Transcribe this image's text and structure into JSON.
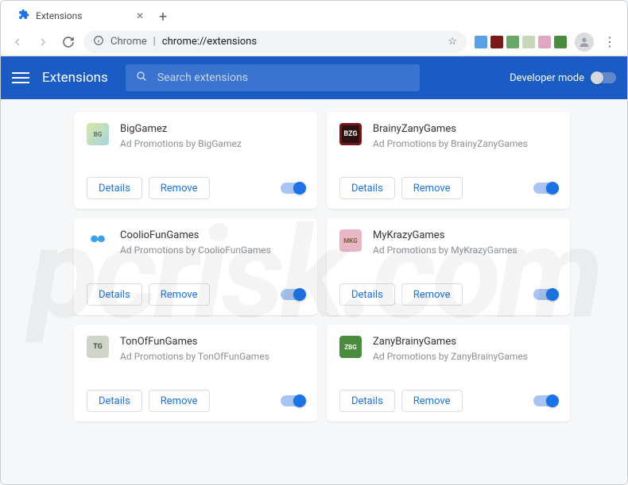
{
  "window": {
    "tab_title": "Extensions"
  },
  "toolbar": {
    "omni_host": "Chrome",
    "omni_url": "chrome://extensions"
  },
  "appbar": {
    "title": "Extensions",
    "search_placeholder": "Search extensions",
    "dev_mode_label": "Developer mode"
  },
  "buttons": {
    "details": "Details",
    "remove": "Remove"
  },
  "extensions": [
    {
      "name": "BigGamez",
      "desc": "Ad Promotions by BigGamez",
      "icon": "bg",
      "abbr": "BG"
    },
    {
      "name": "BrainyZanyGames",
      "desc": "Ad Promotions by BrainyZanyGames",
      "icon": "bzg",
      "abbr": "BZG"
    },
    {
      "name": "CoolioFunGames",
      "desc": "Ad Promotions by CoolioFunGames",
      "icon": "cfg",
      "abbr": ""
    },
    {
      "name": "MyKrazyGames",
      "desc": "Ad Promotions by MyKrazyGames",
      "icon": "mkg",
      "abbr": "MKG"
    },
    {
      "name": "TonOfFunGames",
      "desc": "Ad Promotions by TonOfFunGames",
      "icon": "tg",
      "abbr": "TG"
    },
    {
      "name": "ZanyBrainyGames",
      "desc": "Ad Promotions by ZanyBrainyGames",
      "icon": "zbg",
      "abbr": "ZBG"
    }
  ]
}
